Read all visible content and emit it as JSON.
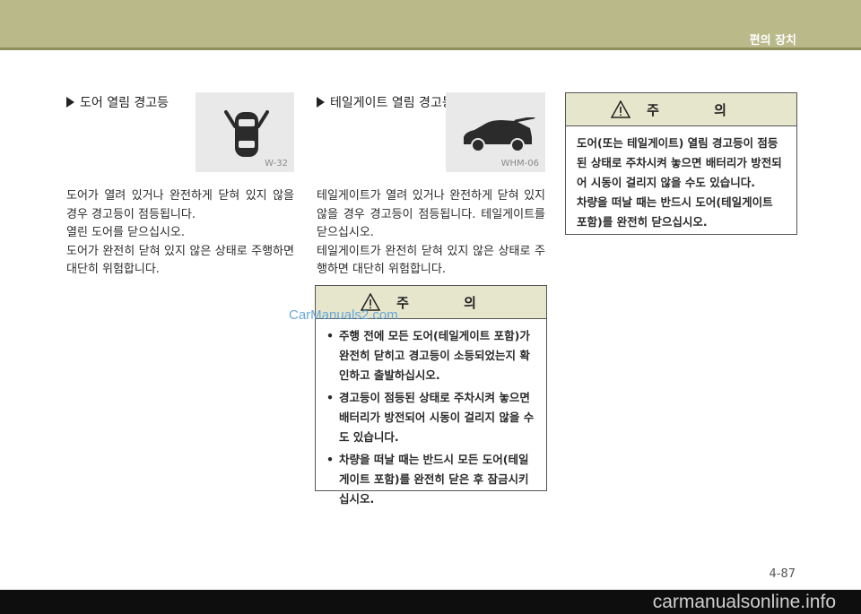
{
  "header": {
    "title": "편의 장치"
  },
  "door_section": {
    "heading": "도어 열림 경고등",
    "icon_code": "W-32",
    "paragraphs": [
      "도어가 열려 있거나 완전하게 닫혀 있지 않을 경우 경고등이 점등됩니다.",
      "열린 도어를 닫으십시오.",
      "도어가 완전히 닫혀 있지 않은 상태로 주행하면 대단히 위험합니다."
    ]
  },
  "tailgate_section": {
    "heading": "테일게이트 열림 경고등",
    "icon_code": "WHM-06",
    "paragraphs": [
      "테일게이트가 열려 있거나 완전하게 닫혀 있지 않을 경우 경고등이 점등됩니다. 테일게이트를 닫으십시오.",
      "테일게이트가 완전히 닫혀 있지 않은 상태로 주행하면 대단히 위험합니다."
    ]
  },
  "caution_middle": {
    "title": "주 의",
    "items": [
      "주행 전에 모든 도어(테일게이트 포함)가 완전히 닫히고 경고등이 소등되었는지 확인하고 출발하십시오.",
      "경고등이 점등된 상태로 주차시켜 놓으면 배터리가 방전되어 시동이 걸리지 않을 수 도 있습니다.",
      "차량을 떠날 때는 반드시 모든 도어(테일게이트 포함)를 완전히 닫은 후 잠금시키십시오."
    ]
  },
  "caution_right": {
    "title": "주 의",
    "paragraphs": [
      "도어(또는 테일게이트) 열림 경고등이 점등된 상태로 주차시켜 놓으면 배터리가 방전되어 시동이 걸리지 않을 수도 있습니다.",
      "차량을 떠날 때는 반드시 도어(테일게이트 포함)를 완전히 닫으십시오."
    ]
  },
  "watermark": "CarManuals2.com",
  "page_number": "4-87",
  "footer": {
    "text": "carmanualsonline.info"
  }
}
